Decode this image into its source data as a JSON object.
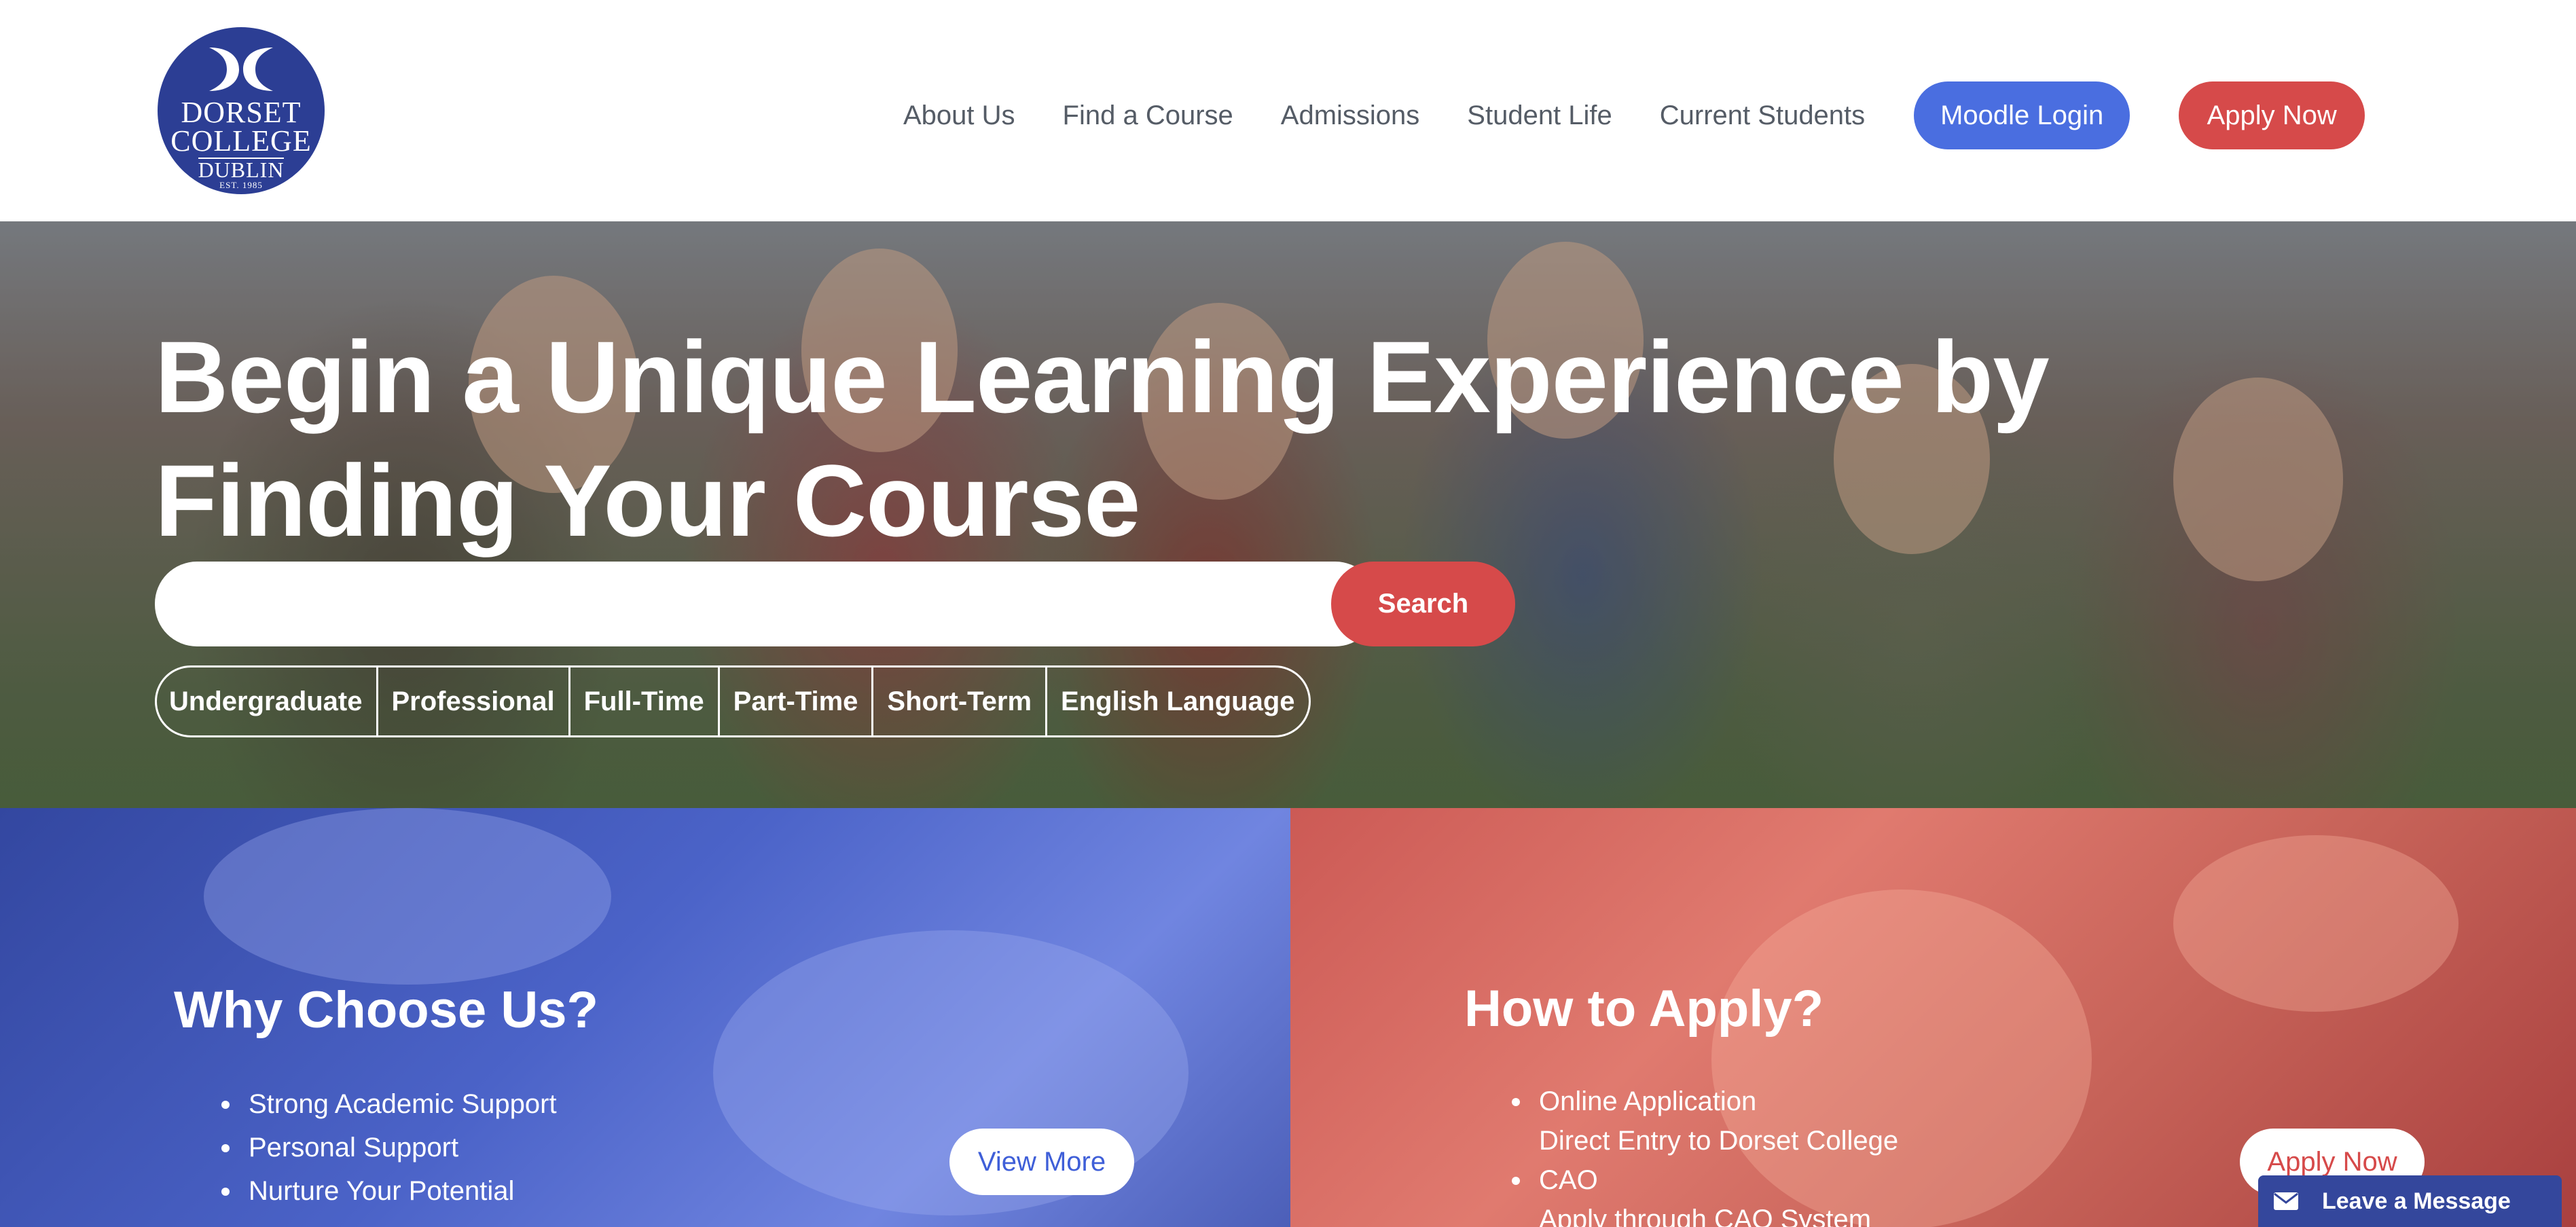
{
  "logo": {
    "line1": "DORSET",
    "line2": "COLLEGE",
    "line3": "DUBLIN",
    "line4": "EST. 1985",
    "icon": "dc-monogram-icon"
  },
  "nav": {
    "items": [
      "About Us",
      "Find a Course",
      "Admissions",
      "Student Life",
      "Current Students"
    ],
    "moodle_label": "Moodle Login",
    "apply_label": "Apply Now"
  },
  "hero": {
    "title": "Begin a Unique Learning Experience by Finding Your Course",
    "search_placeholder": "",
    "search_label": "Search",
    "filters": [
      "Undergraduate",
      "Professional",
      "Full-Time",
      "Part-Time",
      "Short-Term",
      "English Language"
    ]
  },
  "why": {
    "title": "Why Choose Us?",
    "items": [
      "Strong Academic Support",
      "Personal Support",
      "Nurture Your Potential"
    ],
    "button": "View More"
  },
  "apply": {
    "title": "How to Apply?",
    "items": [
      {
        "main": "Online Application",
        "sub": "Direct Entry to Dorset College"
      },
      {
        "main": "CAO",
        "sub": "Apply through CAO System"
      }
    ],
    "button": "Apply Now"
  },
  "chat": {
    "label": "Leave a Message",
    "icon": "envelope-icon"
  },
  "colors": {
    "brand_blue": "#2c3e94",
    "moodle_blue": "#4a6ee0",
    "apply_red": "#d64a4a"
  }
}
